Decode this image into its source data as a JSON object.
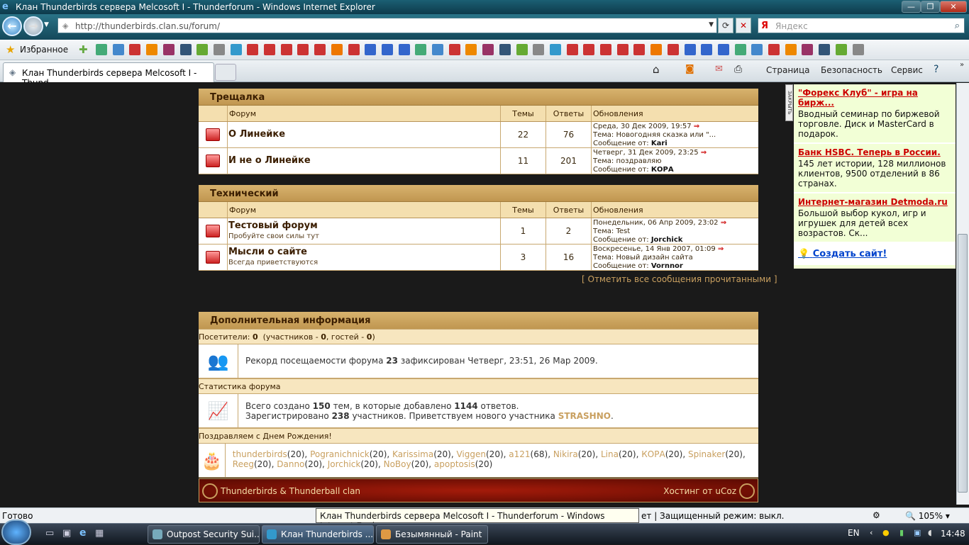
{
  "window": {
    "title": "Клан Thunderbirds сервера Melcosoft I - Thunderforum - Windows Internet Explorer"
  },
  "nav": {
    "url": "http://thunderbirds.clan.su/forum/",
    "search_placeholder": "Яндекс",
    "search_logo": "Я"
  },
  "favbar": {
    "favorites_label": "Избранное"
  },
  "tabs": {
    "active_title": "Клан Thunderbirds сервера Melcosoft I - Thund...",
    "commands": [
      "Страница",
      "Безопасность",
      "Сервис"
    ]
  },
  "forum": {
    "col_forum": "Форум",
    "col_topics": "Темы",
    "col_replies": "Ответы",
    "col_updates": "Обновления",
    "sections": [
      {
        "title": "Трещалка",
        "rows": [
          {
            "name": "О Линейке",
            "desc": "",
            "topics": "22",
            "replies": "76",
            "date": "Среда, 30 Дек 2009, 19:57",
            "topic": "Тема: Новогодняя сказка или \"...",
            "author_label": "Сообщение от:",
            "author": "Kari"
          },
          {
            "name": "И не о Линейке",
            "desc": "",
            "topics": "11",
            "replies": "201",
            "date": "Четверг, 31 Дек 2009, 23:25",
            "topic": "Тема: поздравляю",
            "author_label": "Сообщение от:",
            "author": "КОРА"
          }
        ]
      },
      {
        "title": "Технический",
        "rows": [
          {
            "name": "Тестовый форум",
            "desc": "Пробуйте свои силы тут",
            "topics": "1",
            "replies": "2",
            "date": "Понедельник, 06 Апр 2009, 23:02",
            "topic": "Тема: Test",
            "author_label": "Сообщение от:",
            "author": "Jorchick"
          },
          {
            "name": "Мысли о сайте",
            "desc": "Всегда приветствуются",
            "topics": "3",
            "replies": "16",
            "date": "Воскресенье, 14 Янв 2007, 01:09",
            "topic": "Тема: Новый дизайн сайта",
            "author_label": "Сообщение от:",
            "author": "Vornnor"
          }
        ]
      }
    ],
    "mark_all": "[ Отметить все сообщения прочитанными ]"
  },
  "info": {
    "title": "Дополнительная информация",
    "visitors_label": "Посетители:",
    "visitors": "0",
    "members_label": "участников -",
    "members": "0",
    "guests_label": "гостей -",
    "guests": "0",
    "record_pre": "Рекорд посещаемости форума",
    "record_num": "23",
    "record_post": "зафиксирован Четверг, 23:51, 26 Мар 2009.",
    "stats_title": "Статистика форума",
    "stats_l1_a": "Всего создано",
    "stats_topics": "150",
    "stats_l1_b": "тем, в которые добавлено",
    "stats_posts": "1144",
    "stats_l1_c": "ответов.",
    "stats_l2_a": "Зарегистрировано",
    "stats_users": "238",
    "stats_l2_b": "участников. Приветствуем нового участника",
    "stats_newuser": "STRASHNO",
    "birthday_title": "Поздравляем с Днем Рождения!",
    "birthdays": [
      {
        "name": "thunderbirds",
        "age": "(20)"
      },
      {
        "name": "Pogranichnick",
        "age": "(20)"
      },
      {
        "name": "Karissima",
        "age": "(20)"
      },
      {
        "name": "Viggen",
        "age": "(20)"
      },
      {
        "name": "a121",
        "age": "(68)"
      },
      {
        "name": "Nikira",
        "age": "(20)"
      },
      {
        "name": "Lina",
        "age": "(20)"
      },
      {
        "name": "КОРА",
        "age": "(20)"
      },
      {
        "name": "Spinaker",
        "age": "(20)"
      },
      {
        "name": "Reeg",
        "age": "(20)"
      },
      {
        "name": "Danno",
        "age": "(20)"
      },
      {
        "name": "Jorchick",
        "age": "(20)"
      },
      {
        "name": "NoBoy",
        "age": "(20)"
      },
      {
        "name": "apoptosis",
        "age": "(20)"
      }
    ]
  },
  "footer": {
    "left": "Thunderbirds & Thunderball clan",
    "right_label": "Хостинг от",
    "right_link": "uCoz"
  },
  "ads": [
    {
      "title": "\"Форекс Клуб\" - игра на бирж...",
      "text": "Вводный семинар по биржевой торговле. Диск и MasterCard в подарок."
    },
    {
      "title": "Банк HSBC. Теперь в России.",
      "text": "145 лет истории, 128 миллионов клиентов, 9500 отделений в 86 странах."
    },
    {
      "title": "Интернет-магазин Detmoda.ru",
      "text": "Большой выбор кукол, игр и игрушек для детей всех возрастов. Ск..."
    }
  ],
  "ads_create": "Создать сайт!",
  "ads_close": "ЗАКРЫТЬ",
  "status": {
    "text": "Готово",
    "tooltip": "Клан Thunderbirds сервера Melcosoft I - Thunderforum - Windows Internet Explore",
    "protected_tail": "ет | Защищенный режим: выкл.",
    "zoom": "105%"
  },
  "taskbar": {
    "items": [
      "Outpost Security Sui...",
      "Клан Thunderbirds ...",
      "Безымянный - Paint"
    ],
    "lang": "EN",
    "clock": "14:48"
  },
  "colors": {
    "header_gold": "#c09650",
    "footer_red": "#a41b0a",
    "link_gold": "#c9a060",
    "ad_title": "#cc0000"
  }
}
